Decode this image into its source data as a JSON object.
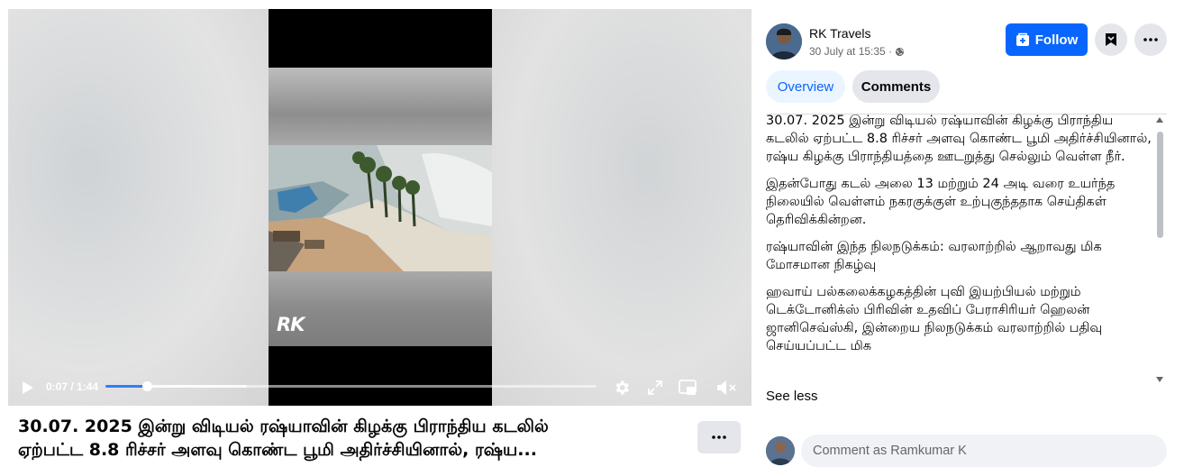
{
  "video": {
    "logo_text": "RK",
    "time_current": "0:07",
    "time_sep": " / ",
    "time_total": "1:44",
    "progress_fraction": 0.084
  },
  "post_title": {
    "line1": "30.07. 2025 இன்று விடியல் ரஷ்யாவின் கிழக்கு பிராந்திய கடலில்",
    "line2": "ஏற்பட்ட 8.8 ரிச்சர் அளவு கொண்ட பூமி அதிர்ச்சியினால், ரஷ்ய..."
  },
  "author": {
    "name": "RK Travels",
    "date": "30 July at 15:35 ·",
    "privacy_icon": "globe-icon"
  },
  "actions": {
    "follow_label": "Follow"
  },
  "tabs": [
    {
      "label": "Overview"
    },
    {
      "label": "Comments"
    }
  ],
  "description": [
    "30.07. 2025 இன்று விடியல் ரஷ்யாவின் கிழக்கு பிராந்திய கடலில் ஏற்பட்ட 8.8 ரிச்சர் அளவு கொண்ட பூமி அதிர்ச்சியினால், ரஷ்ய கிழக்கு பிராந்தியத்தை ஊடறுத்து செல்லும் வெள்ள நீர்.",
    "இதன்போது கடல் அலை 13 மற்றும் 24 அடி வரை உயர்ந்த\nநிலையில் வெள்ளம் நகரகுக்குள் உற்புகுந்ததாக செய்திகள் தெரிவிக்கின்றன.",
    "ரஷ்யாவின் இந்த நிலநடுக்கம்: வரலாற்றில் ஆறாவது மிக மோசமான நிகழ்வு",
    "ஹவாய் பல்கலைக்கழகத்தின் புவி இயற்பியல் மற்றும் டெக்டோனிக்ஸ் பிரிவின் உதவிப் பேராசிரியர் ஹெலன் ஜானிசெவ்ஸ்கி, இன்றைய நிலநடுக்கம் வரலாற்றில் பதிவு செய்யப்பட்ட மிக"
  ],
  "see_less_label": "See less",
  "comment": {
    "placeholder": "Comment as Ramkumar K"
  },
  "colors": {
    "accent": "#0866ff",
    "progress": "#2d7ff9",
    "button_bg": "#e4e6eb"
  }
}
